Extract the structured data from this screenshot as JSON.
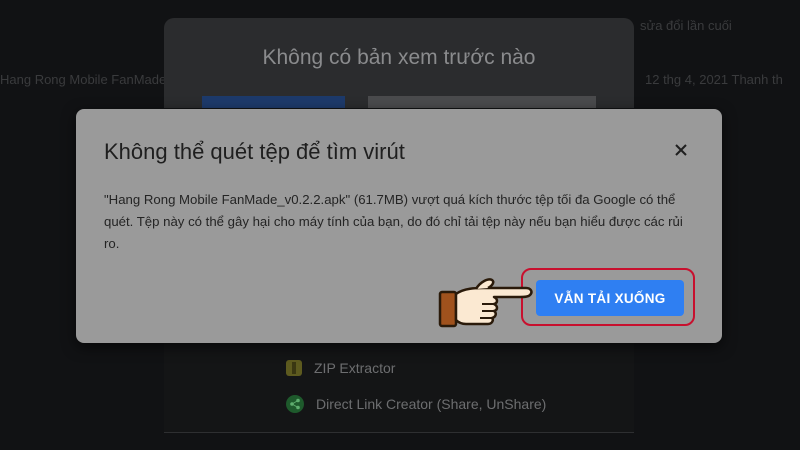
{
  "background": {
    "top_right_text": "sửa đổi lần cuối",
    "left_text": "Hang Rong Mobile FanMade",
    "right_text": "12 thg 4, 2021  Thanh th"
  },
  "preview": {
    "title": "Không có bản xem trước nào"
  },
  "menu": {
    "items": [
      {
        "label": "ZIP Extractor",
        "icon": "zip-extractor-icon"
      },
      {
        "label": "Direct Link Creator (Share, UnShare)",
        "icon": "share-icon"
      }
    ]
  },
  "dialog": {
    "title": "Không thể quét tệp để tìm virút",
    "close_label": "×",
    "message": "\"Hang Rong Mobile FanMade_v0.2.2.apk\" (61.7MB) vượt quá kích thước tệp tối đa Google có thể quét. Tệp này có thể gây hại cho máy tính của bạn, do đó chỉ tải tệp này nếu bạn hiểu được các rủi ro.",
    "download_label": "VẪN TẢI XUỐNG"
  },
  "colors": {
    "accent": "#2f7ff2",
    "highlight": "#c8102e",
    "dialog_bg": "#9a9a9a",
    "page_bg": "#111214"
  }
}
